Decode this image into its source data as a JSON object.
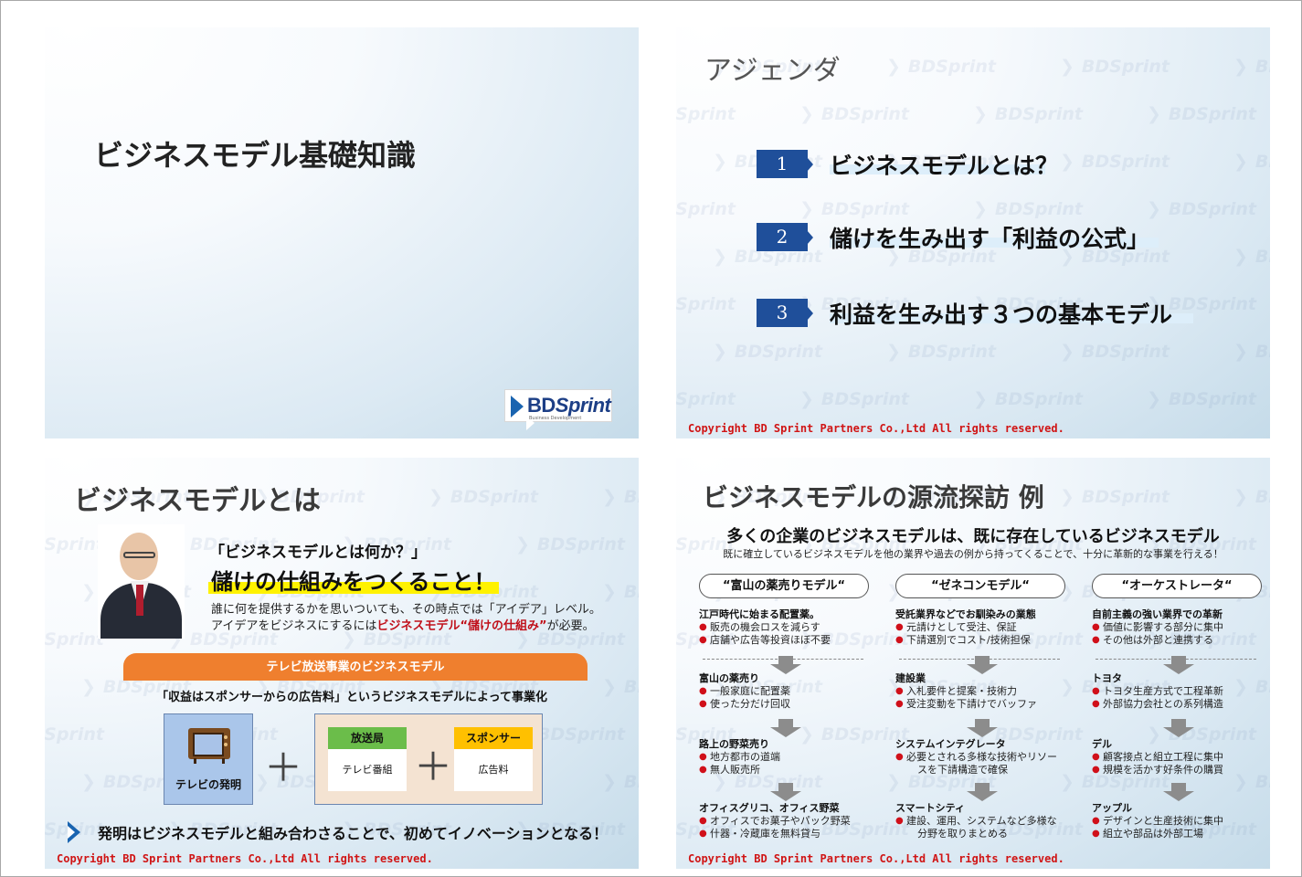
{
  "watermark": "BDSprint",
  "slide1": {
    "title": "ビジネスモデル基礎知識",
    "logo_text": "BD",
    "logo_text_italic": "Sprint",
    "logo_sub": "Business Development"
  },
  "slide2": {
    "title": "アジェンダ",
    "items": [
      {
        "num": "1",
        "text": "ビジネスモデルとは？"
      },
      {
        "num": "2",
        "text": "儲けを生み出す「利益の公式」"
      },
      {
        "num": "3",
        "text": "利益を生み出す３つの基本モデル"
      }
    ],
    "copyright": "Copyright BD Sprint Partners Co.,Ltd  All rights reserved."
  },
  "slide3": {
    "title": "ビジネスモデルとは",
    "question": "「ビジネスモデルとは何か？」",
    "answer": "儲けの仕組みをつくること！",
    "desc_line1": "誰に何を提供するかを思いついても、その時点では「アイデア」レベル。",
    "desc_line2_pre": "アイデアをビジネスにするには",
    "desc_line2_red": "ビジネスモデル“儲けの仕組み”",
    "desc_line2_post": "が必要。",
    "banner": "テレビ放送事業のビジネスモデル",
    "subline": "「収益はスポンサーからの広告料」というビジネスモデルによって事業化",
    "tv_label": "テレビの発明",
    "plus": "＋",
    "card1_head": "放送局",
    "card1_body": "テレビ番組",
    "card2_head": "スポンサー",
    "card2_body": "広告料",
    "conclusion": "発明はビジネスモデルと組み合わさることで、初めてイノベーションとなる！",
    "copyright": "Copyright BD Sprint Partners Co.,Ltd  All rights reserved."
  },
  "slide4": {
    "title": "ビジネスモデルの源流探訪 例",
    "sub1": "多くの企業のビジネスモデルは、既に存在しているビジネスモデル",
    "sub2": "既に確立しているビジネスモデルを他の業界や過去の例から持ってくることで、十分に革新的な事業を行える！",
    "columns": [
      {
        "header": "“富山の薬売りモデル“",
        "intro": {
          "head": "江戸時代に始まる配置薬。",
          "items": [
            "販売の機会ロスを減らす",
            "店舗や広告等投資ほぼ不要"
          ]
        },
        "examples": [
          {
            "head": "富山の薬売り",
            "items": [
              "一般家庭に配置薬",
              "使った分だけ回収"
            ]
          },
          {
            "head": "路上の野菜売り",
            "items": [
              "地方都市の道端",
              "無人販売所"
            ]
          },
          {
            "head": "オフィスグリコ、オフィス野菜",
            "items": [
              "オフィスでお菓子やパック野菜",
              "什器・冷蔵庫を無料貸与"
            ]
          }
        ]
      },
      {
        "header": "“ゼネコンモデル“",
        "intro": {
          "head": "受託業界などでお馴染みの業態",
          "items": [
            "元請けとして受注、保証",
            "下請選別でコスト/技術担保"
          ]
        },
        "examples": [
          {
            "head": "建設業",
            "items": [
              "入札要件と提案・技術力",
              "受注変動を下請けでバッファ"
            ]
          },
          {
            "head": "システムインテグレータ",
            "items": [
              "必要とされる多様な技術やリソー"
            ],
            "cont": "スを下請構造で確保"
          },
          {
            "head": "スマートシティ",
            "items": [
              "建設、運用、システムなど多様な"
            ],
            "cont": "分野を取りまとめる"
          }
        ]
      },
      {
        "header": "“オーケストレータ“",
        "intro": {
          "head": "自前主義の強い業界での革新",
          "items": [
            "価値に影響する部分に集中",
            "その他は外部と連携する"
          ]
        },
        "examples": [
          {
            "head": "トヨタ",
            "items": [
              "トヨタ生産方式で工程革新",
              "外部協力会社との系列構造"
            ]
          },
          {
            "head": "デル",
            "items": [
              "顧客接点と組立工程に集中",
              "規模を活かす好条件の購買"
            ]
          },
          {
            "head": "アップル",
            "items": [
              "デザインと生産技術に集中",
              "組立や部品は外部工場"
            ]
          }
        ]
      }
    ],
    "copyright": "Copyright BD Sprint Partners Co.,Ltd  All rights reserved."
  }
}
